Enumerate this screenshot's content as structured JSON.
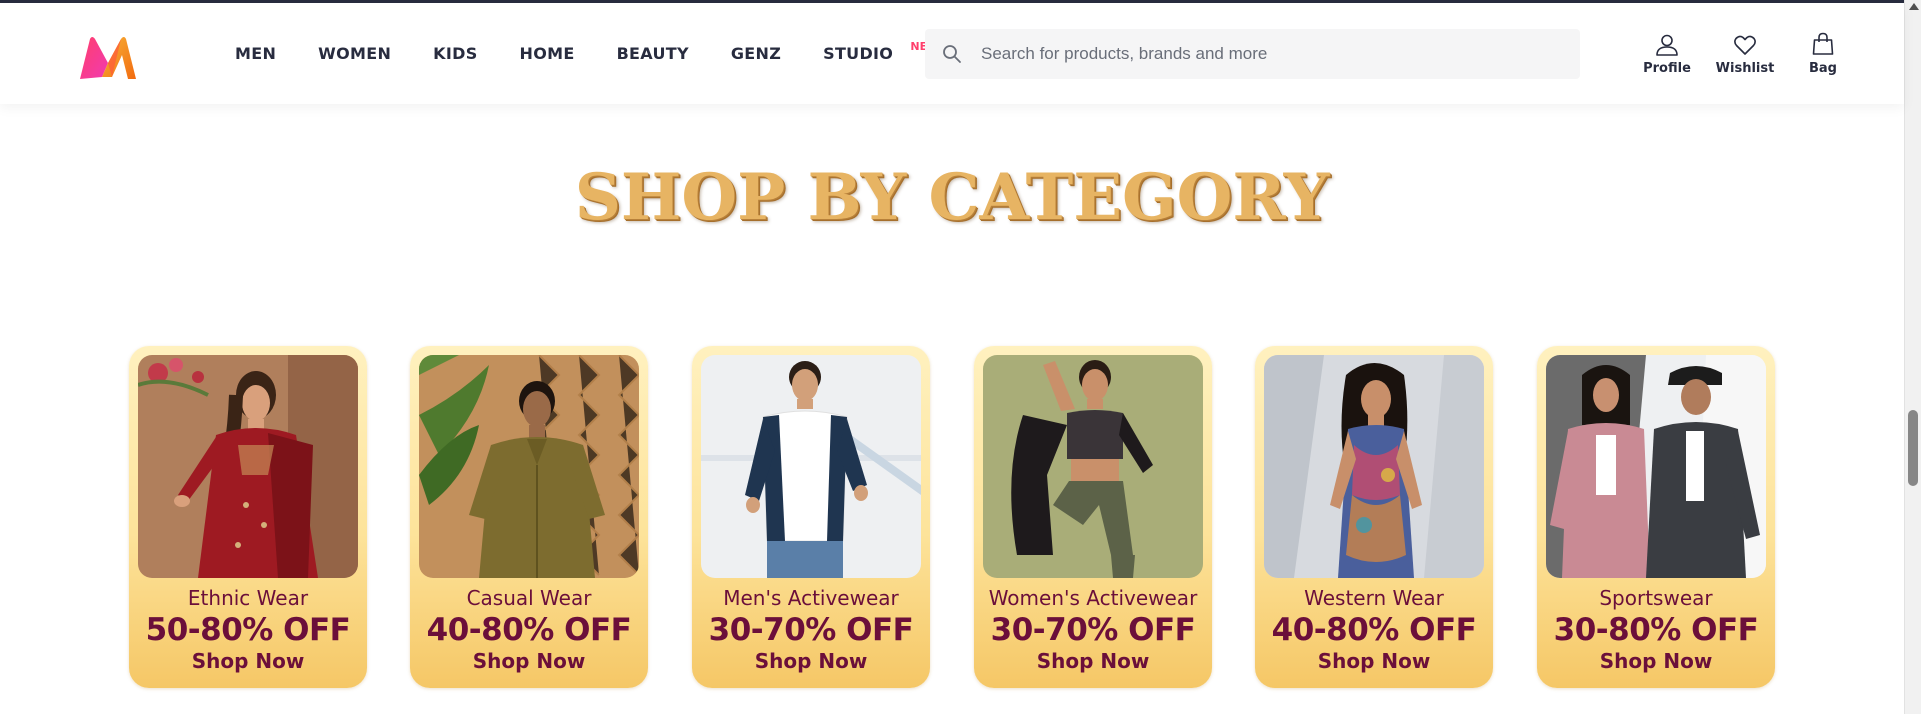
{
  "colors": {
    "brand_pink": "#ff3f6c",
    "brand_orange": "#f26a10",
    "text_dark": "#282c3f",
    "card_text": "#6b0f3a",
    "title_gold": "#e7b463"
  },
  "header": {
    "logo_icon": "myntra-logo",
    "nav": [
      {
        "label": "MEN"
      },
      {
        "label": "WOMEN"
      },
      {
        "label": "KIDS"
      },
      {
        "label": "HOME"
      },
      {
        "label": "BEAUTY"
      },
      {
        "label": "GENZ"
      },
      {
        "label": "STUDIO",
        "badge": "NEW"
      }
    ],
    "search": {
      "icon": "search-icon",
      "placeholder": "Search for products, brands and more",
      "value": ""
    },
    "actions": [
      {
        "label": "Profile",
        "icon": "user-icon"
      },
      {
        "label": "Wishlist",
        "icon": "heart-icon"
      },
      {
        "label": "Bag",
        "icon": "bag-icon"
      }
    ]
  },
  "section": {
    "title": "SHOP BY CATEGORY"
  },
  "categories": [
    {
      "name": "Ethnic Wear",
      "offer": "50-80% OFF",
      "cta": "Shop Now",
      "image": "woman-in-red-ethnic-dress"
    },
    {
      "name": "Casual Wear",
      "offer": "40-80% OFF",
      "cta": "Shop Now",
      "image": "man-in-olive-shirt"
    },
    {
      "name": "Men's Activewear",
      "offer": "30-70% OFF",
      "cta": "Shop Now",
      "image": "man-in-activewear"
    },
    {
      "name": "Women's Activewear",
      "offer": "30-70% OFF",
      "cta": "Shop Now",
      "image": "woman-in-sports-bra"
    },
    {
      "name": "Western Wear",
      "offer": "40-80% OFF",
      "cta": "Shop Now",
      "image": "woman-in-printed-top"
    },
    {
      "name": "Sportswear",
      "offer": "30-80% OFF",
      "cta": "Shop Now",
      "image": "couple-in-sports-jackets"
    }
  ]
}
